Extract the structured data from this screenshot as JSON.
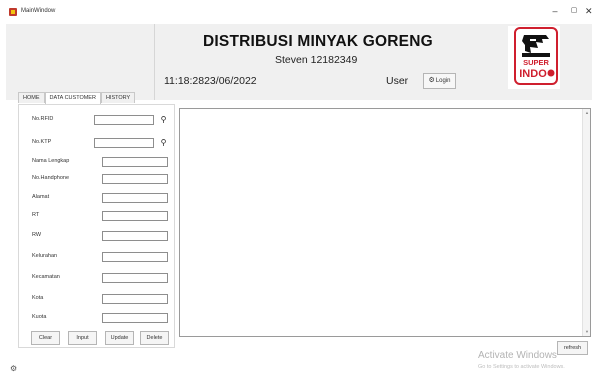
{
  "window": {
    "title": "MainWindow",
    "minimize": "–",
    "maximize": "▢",
    "close": "✕"
  },
  "header": {
    "title": "DISTRIBUSI MINYAK GORENG",
    "subtitle": "Steven 12182349",
    "datetime": "11:18:2823/06/2022",
    "user_label": "User",
    "login_label": "Login",
    "logo_text_top": "SUPER",
    "logo_text_bottom": "INDO"
  },
  "tabs": [
    {
      "label": "HOME"
    },
    {
      "label": "DATA CUSTOMER"
    },
    {
      "label": "HISTORY"
    }
  ],
  "form": {
    "fields": [
      {
        "label": "No.RFID",
        "value": ""
      },
      {
        "label": "No.KTP",
        "value": ""
      },
      {
        "label": "Nama Lengkap",
        "value": ""
      },
      {
        "label": "No.Handphone",
        "value": ""
      },
      {
        "label": "Alamat",
        "value": ""
      },
      {
        "label": "RT",
        "value": ""
      },
      {
        "label": "RW",
        "value": ""
      },
      {
        "label": "Kelurahan",
        "value": ""
      },
      {
        "label": "Kecamatan",
        "value": ""
      },
      {
        "label": "Kota",
        "value": ""
      },
      {
        "label": "Kuota",
        "value": ""
      }
    ],
    "buttons": {
      "clear": "Clear",
      "input": "Input",
      "update": "Update",
      "delete": "Delete"
    }
  },
  "refresh_label": "refresh",
  "watermark": {
    "title": "Activate Windows",
    "subtitle": "Go to Settings to activate Windows."
  },
  "colors": {
    "logo_red": "#cf1f2e",
    "header_bg": "#f0f0f0"
  }
}
